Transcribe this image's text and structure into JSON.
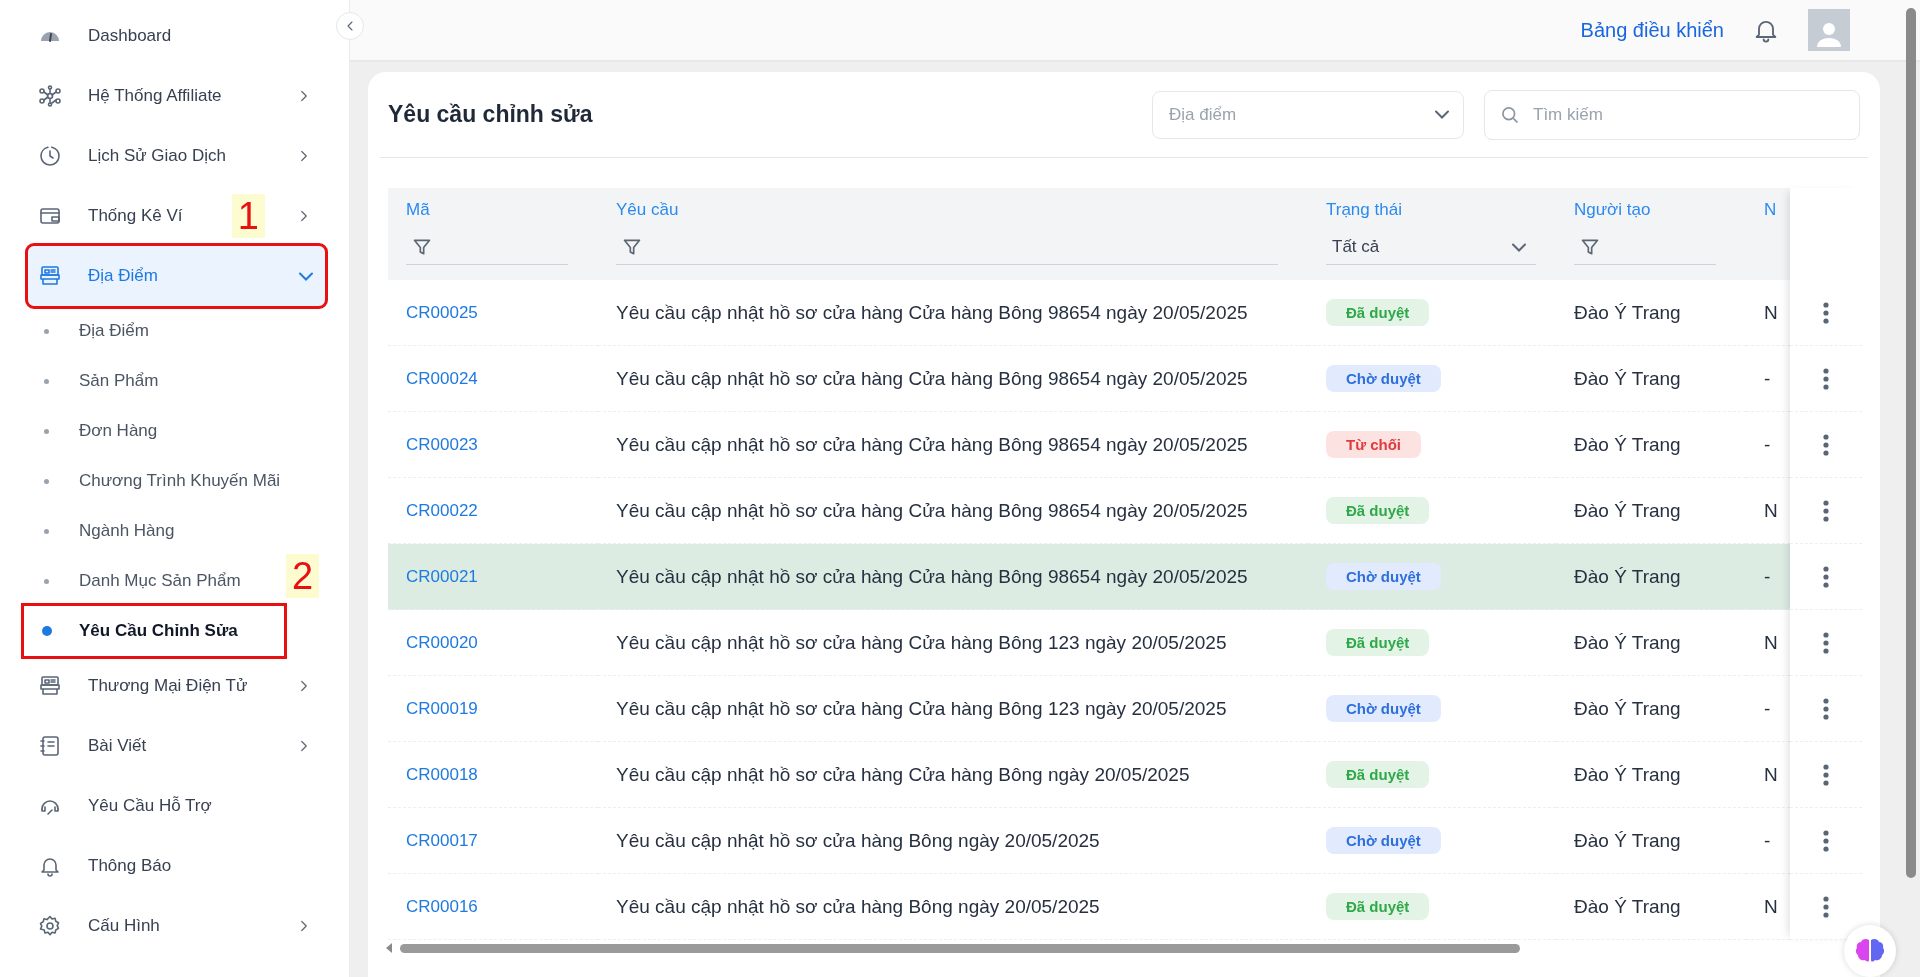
{
  "sidebar": {
    "items": [
      {
        "label": "Dashboard",
        "expandable": false,
        "expanded": false,
        "selected": false,
        "highlighted": false
      },
      {
        "label": "Hệ Thống Affiliate",
        "expandable": true,
        "expanded": false,
        "selected": false,
        "highlighted": false
      },
      {
        "label": "Lịch Sử Giao Dịch",
        "expandable": true,
        "expanded": false,
        "selected": false,
        "highlighted": false
      },
      {
        "label": "Thống Kê Ví",
        "expandable": true,
        "expanded": false,
        "selected": false,
        "highlighted": false,
        "annotation": "1"
      },
      {
        "label": "Địa Điểm",
        "expandable": true,
        "expanded": true,
        "selected": true,
        "highlighted": true,
        "children": [
          {
            "label": "Địa Điểm",
            "selected": false,
            "highlighted": false
          },
          {
            "label": "Sản Phẩm",
            "selected": false,
            "highlighted": false
          },
          {
            "label": "Đơn Hàng",
            "selected": false,
            "highlighted": false
          },
          {
            "label": "Chương Trình Khuyến Mãi",
            "selected": false,
            "highlighted": false
          },
          {
            "label": "Ngành Hàng",
            "selected": false,
            "highlighted": false
          },
          {
            "label": "Danh Mục Sản Phẩm",
            "selected": false,
            "highlighted": false,
            "annotation": "2"
          },
          {
            "label": "Yêu Cầu Chỉnh Sửa",
            "selected": true,
            "highlighted": true
          }
        ]
      },
      {
        "label": "Thương Mại Điện Tử",
        "expandable": true,
        "expanded": false,
        "selected": false,
        "highlighted": false
      },
      {
        "label": "Bài Viết",
        "expandable": true,
        "expanded": false,
        "selected": false,
        "highlighted": false
      },
      {
        "label": "Yêu Cầu Hỗ Trợ",
        "expandable": false,
        "expanded": false,
        "selected": false,
        "highlighted": false
      },
      {
        "label": "Thông Báo",
        "expandable": false,
        "expanded": false,
        "selected": false,
        "highlighted": false
      },
      {
        "label": "Cấu Hình",
        "expandable": true,
        "expanded": false,
        "selected": false,
        "highlighted": false
      }
    ]
  },
  "header": {
    "link": "Bảng điều khiển"
  },
  "card": {
    "title": "Yêu cầu chỉnh sửa",
    "location_select": {
      "placeholder": "Địa điểm"
    },
    "search": {
      "placeholder": "Tìm kiếm"
    },
    "table": {
      "columns": [
        {
          "label": "Mã",
          "kind": "icon"
        },
        {
          "label": "Yêu cầu",
          "kind": "icon"
        },
        {
          "label": "Trạng thái",
          "kind": "select",
          "value": "Tất cả"
        },
        {
          "label": "Người tạo",
          "kind": "icon"
        },
        {
          "label": "N",
          "kind": "none"
        }
      ],
      "rows": [
        {
          "code": "CR00025",
          "request": "Yêu cầu cập nhật hồ sơ cửa hàng Cửa hàng Bông 98654 ngày 20/05/2025",
          "status": "Đã duyệt",
          "kind": "approved",
          "creator": "Đào Ý Trang",
          "column_5": "N",
          "hovered": false
        },
        {
          "code": "CR00024",
          "request": "Yêu cầu cập nhật hồ sơ cửa hàng Cửa hàng Bông 98654 ngày 20/05/2025",
          "status": "Chờ duyệt",
          "kind": "pending",
          "creator": "Đào Ý Trang",
          "column_5": "-",
          "hovered": false
        },
        {
          "code": "CR00023",
          "request": "Yêu cầu cập nhật hồ sơ cửa hàng Cửa hàng Bông 98654 ngày 20/05/2025",
          "status": "Từ chối",
          "kind": "rejected",
          "creator": "Đào Ý Trang",
          "column_5": "-",
          "hovered": false
        },
        {
          "code": "CR00022",
          "request": "Yêu cầu cập nhật hồ sơ cửa hàng Cửa hàng Bông 98654 ngày 20/05/2025",
          "status": "Đã duyệt",
          "kind": "approved",
          "creator": "Đào Ý Trang",
          "column_5": "N",
          "hovered": false
        },
        {
          "code": "CR00021",
          "request": "Yêu cầu cập nhật hồ sơ cửa hàng Cửa hàng Bông 98654 ngày 20/05/2025",
          "status": "Chờ duyệt",
          "kind": "pending",
          "creator": "Đào Ý Trang",
          "column_5": "-",
          "hovered": true
        },
        {
          "code": "CR00020",
          "request": "Yêu cầu cập nhật hồ sơ cửa hàng Cửa hàng Bông 123 ngày 20/05/2025",
          "status": "Đã duyệt",
          "kind": "approved",
          "creator": "Đào Ý Trang",
          "column_5": "N",
          "hovered": false
        },
        {
          "code": "CR00019",
          "request": "Yêu cầu cập nhật hồ sơ cửa hàng Cửa hàng Bông 123 ngày 20/05/2025",
          "status": "Chờ duyệt",
          "kind": "pending",
          "creator": "Đào Ý Trang",
          "column_5": "-",
          "hovered": false
        },
        {
          "code": "CR00018",
          "request": "Yêu cầu cập nhật hồ sơ cửa hàng Cửa hàng Bông ngày 20/05/2025",
          "status": "Đã duyệt",
          "kind": "approved",
          "creator": "Đào Ý Trang",
          "column_5": "N",
          "hovered": false
        },
        {
          "code": "CR00017",
          "request": "Yêu cầu cập nhật hồ sơ cửa hàng Bông ngày 20/05/2025",
          "status": "Chờ duyệt",
          "kind": "pending",
          "creator": "Đào Ý Trang",
          "column_5": "-",
          "hovered": false
        },
        {
          "code": "CR00016",
          "request": "Yêu cầu cập nhật hồ sơ cửa hàng Bông ngày 20/05/2025",
          "status": "Đã duyệt",
          "kind": "approved",
          "creator": "Đào Ý Trang",
          "column_5": "N",
          "hovered": false
        }
      ]
    }
  }
}
